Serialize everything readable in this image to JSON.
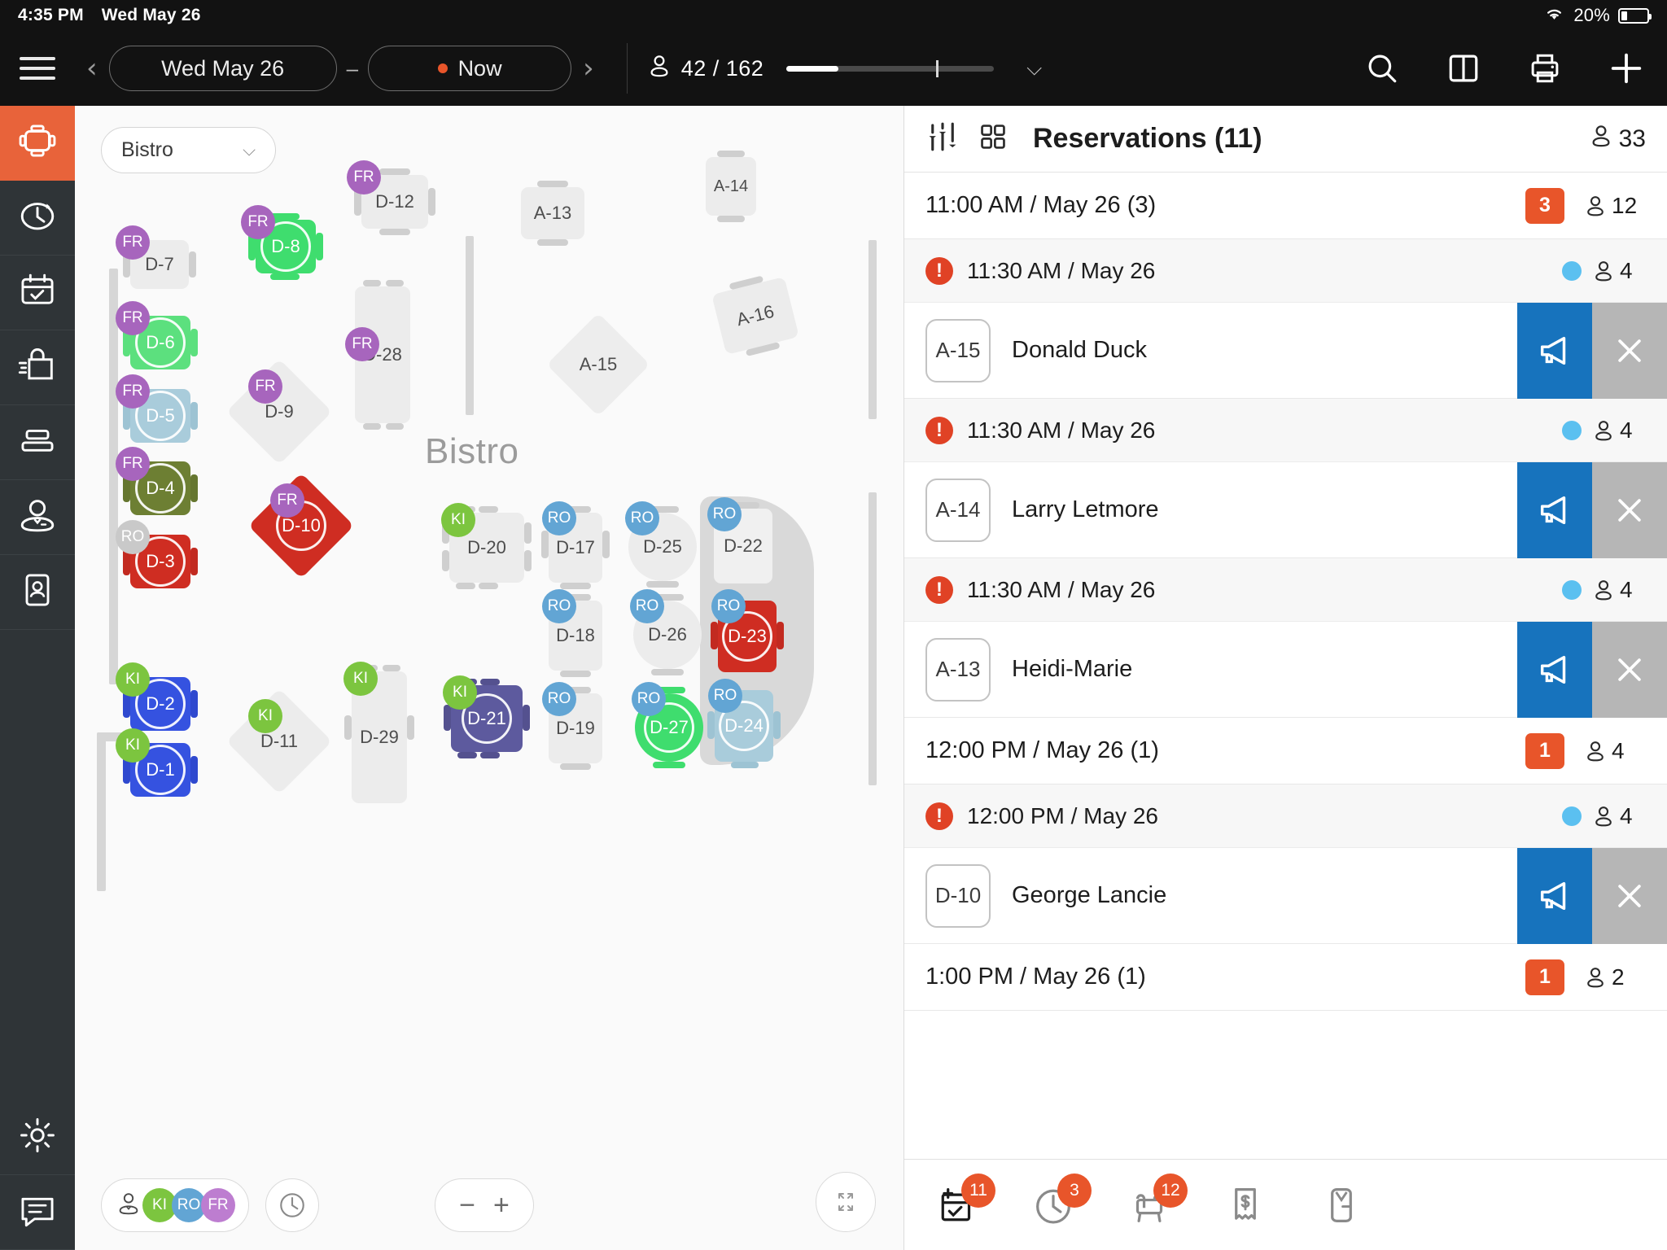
{
  "statusbar": {
    "time": "4:35 PM",
    "date": "Wed May 26",
    "battery_pct": "20%",
    "wifi_icon": "wifi-icon",
    "battery_icon": "battery-icon"
  },
  "toolbar": {
    "menu_icon": "hamburger-menu-icon",
    "prev_label": "‹",
    "next_label": "›",
    "date_label": "Wed May 26",
    "range_dash": "–",
    "now_label": "Now",
    "occupancy": "42 / 162",
    "occupancy_icon": "guest-pin-icon",
    "chevron_label": "⌵",
    "search_icon": "search-icon",
    "split_view_icon": "split-view-icon",
    "print_icon": "print-icon",
    "add_icon": "plus-icon"
  },
  "rail": {
    "items": [
      {
        "name": "floorplan",
        "icon": "table-layout-icon",
        "active": true
      },
      {
        "name": "timeline",
        "icon": "clock-history-icon",
        "active": false
      },
      {
        "name": "calendar",
        "icon": "calendar-check-icon",
        "active": false
      },
      {
        "name": "orders",
        "icon": "shopping-bag-icon",
        "active": false
      },
      {
        "name": "list",
        "icon": "list-rows-icon",
        "active": false
      },
      {
        "name": "staff",
        "icon": "waiter-icon",
        "active": false
      },
      {
        "name": "guests",
        "icon": "contact-card-icon",
        "active": false
      }
    ],
    "bottom": [
      {
        "name": "settings",
        "icon": "gear-icon"
      },
      {
        "name": "messages",
        "icon": "chat-bubble-icon"
      }
    ]
  },
  "floor": {
    "area_label": "Bistro",
    "area_chevron": "⌵",
    "room_label": "Bistro",
    "controls": {
      "staff_icon": "waiter-icon",
      "team_badges": [
        "KI",
        "RO",
        "FR"
      ],
      "clock_icon": "clock-icon",
      "zoom_out": "−",
      "zoom_in": "+",
      "expand_icon": "expand-arrows-icon"
    },
    "tables": [
      {
        "id": "D-7",
        "badge": "FR",
        "color": "plain"
      },
      {
        "id": "D-8",
        "badge": "FR",
        "color": "green"
      },
      {
        "id": "D-6",
        "badge": "FR",
        "color": "green"
      },
      {
        "id": "D-5",
        "badge": "FR",
        "color": "lightblue"
      },
      {
        "id": "D-4",
        "badge": "FR",
        "color": "olive"
      },
      {
        "id": "D-3",
        "badge": "RO",
        "color": "red"
      },
      {
        "id": "D-2",
        "badge": "KI",
        "color": "blue"
      },
      {
        "id": "D-1",
        "badge": "KI",
        "color": "blue"
      },
      {
        "id": "D-12",
        "badge": "FR",
        "color": "plain"
      },
      {
        "id": "D-28",
        "badge": "FR",
        "color": "plain"
      },
      {
        "id": "D-9",
        "badge": "FR",
        "color": "plain"
      },
      {
        "id": "D-10",
        "badge": "FR",
        "color": "red"
      },
      {
        "id": "D-11",
        "badge": "KI",
        "color": "plain"
      },
      {
        "id": "D-29",
        "badge": "KI",
        "color": "plain"
      },
      {
        "id": "D-20",
        "badge": "KI",
        "color": "plain"
      },
      {
        "id": "D-21",
        "badge": "KI",
        "color": "purple"
      },
      {
        "id": "A-13",
        "badge": "",
        "color": "plain"
      },
      {
        "id": "A-14",
        "badge": "",
        "color": "plain"
      },
      {
        "id": "A-15",
        "badge": "",
        "color": "plain"
      },
      {
        "id": "A-16",
        "badge": "",
        "color": "plain"
      },
      {
        "id": "D-17",
        "badge": "RO",
        "color": "plain"
      },
      {
        "id": "D-18",
        "badge": "RO",
        "color": "plain"
      },
      {
        "id": "D-19",
        "badge": "RO",
        "color": "plain"
      },
      {
        "id": "D-25",
        "badge": "RO",
        "color": "plain"
      },
      {
        "id": "D-26",
        "badge": "RO",
        "color": "plain"
      },
      {
        "id": "D-22",
        "badge": "RO",
        "color": "plain"
      },
      {
        "id": "D-23",
        "badge": "RO",
        "color": "red"
      },
      {
        "id": "D-24",
        "badge": "RO",
        "color": "lightblue"
      },
      {
        "id": "D-27",
        "badge": "RO",
        "color": "green"
      }
    ]
  },
  "panel": {
    "filter_icon": "sliders-icon",
    "grid_icon": "grid-view-icon",
    "title": "Reservations (11)",
    "guest_icon": "guest-pin-icon",
    "guest_total": "33",
    "rows": [
      {
        "kind": "group",
        "time": "11:00 AM / May 26 (3)",
        "chip": "3",
        "pax": "12"
      },
      {
        "kind": "sub",
        "time": "11:30 AM / May 26",
        "pax": "4"
      },
      {
        "kind": "res",
        "table": "A-15",
        "guest": "Donald Duck",
        "announce_icon": "megaphone-icon",
        "cancel_icon": "close-icon"
      },
      {
        "kind": "sub",
        "time": "11:30 AM / May 26",
        "pax": "4"
      },
      {
        "kind": "res",
        "table": "A-14",
        "guest": "Larry Letmore",
        "announce_icon": "megaphone-icon",
        "cancel_icon": "close-icon"
      },
      {
        "kind": "sub",
        "time": "11:30 AM / May 26",
        "pax": "4"
      },
      {
        "kind": "res",
        "table": "A-13",
        "guest": "Heidi-Marie",
        "announce_icon": "megaphone-icon",
        "cancel_icon": "close-icon"
      },
      {
        "kind": "group",
        "time": "12:00 PM / May 26 (1)",
        "chip": "1",
        "pax": "4"
      },
      {
        "kind": "sub",
        "time": "12:00 PM / May 26",
        "pax": "4"
      },
      {
        "kind": "res",
        "table": "D-10",
        "guest": "George Lancie",
        "announce_icon": "megaphone-icon",
        "cancel_icon": "close-icon"
      },
      {
        "kind": "group",
        "time": "1:00 PM / May 26 (1)",
        "chip": "1",
        "pax": "2"
      }
    ],
    "footer": [
      {
        "name": "reservations",
        "icon": "calendar-add-icon",
        "badge": "11"
      },
      {
        "name": "waitlist",
        "icon": "clock-icon",
        "badge": "3"
      },
      {
        "name": "seated",
        "icon": "armchair-icon",
        "badge": "12"
      },
      {
        "name": "bills",
        "icon": "receipt-icon",
        "badge": ""
      },
      {
        "name": "staff",
        "icon": "waiter-icon",
        "badge": ""
      }
    ]
  },
  "colors": {
    "accent": "#e8552a",
    "rail_bg": "#2f3437",
    "topbar_bg": "#121212",
    "blue_action": "#1773bd",
    "grey_action": "#b6b6b6",
    "badge_fr": "#a765bd",
    "badge_ro": "#62a5d4",
    "badge_ki": "#7cc53f"
  }
}
